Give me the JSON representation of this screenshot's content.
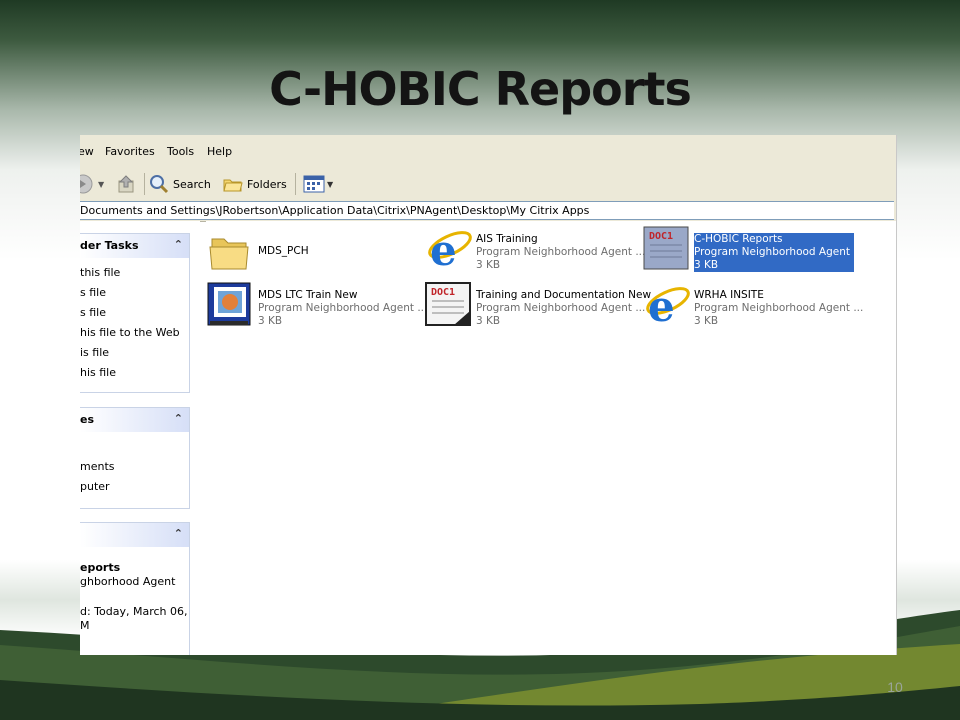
{
  "slide": {
    "title": "C-HOBIC Reports",
    "page_number": "10"
  },
  "menu": [
    "ew",
    "Favorites",
    "Tools",
    "Help"
  ],
  "toolbar": {
    "search_label": "Search",
    "folders_label": "Folders"
  },
  "address": {
    "path": "Documents and Settings\\JRobertson\\Application Data\\Citrix\\PNAgent\\Desktop\\My Citrix Apps"
  },
  "left_panel": {
    "tasks": {
      "title": "der Tasks",
      "items": [
        "this file",
        "s file",
        "s file",
        "his file to the Web",
        "is file",
        "his file"
      ]
    },
    "places": {
      "title": "es",
      "items": [
        "ments",
        "puter"
      ]
    },
    "details": {
      "title": "",
      "name": "eports",
      "type": "ghborhood Agent",
      "modified": "d: Today, March 06,",
      "time": "M"
    }
  },
  "files": [
    {
      "name": "MDS_PCH",
      "desc": "",
      "size": "",
      "icon": "folder-icon"
    },
    {
      "name": "AIS Training",
      "desc": "Program Neighborhood Agent ...",
      "size": "3 KB",
      "icon": "ie-icon"
    },
    {
      "name": "C-HOBIC Reports",
      "desc": "Program Neighborhood Agent ...",
      "size": "3 KB",
      "icon": "document-icon"
    },
    {
      "name": "MDS LTC Train New",
      "desc": "Program Neighborhood Agent ...",
      "size": "3 KB",
      "icon": "app-window-icon"
    },
    {
      "name": "Training and Documentation New",
      "desc": "Program Neighborhood Agent ...",
      "size": "3 KB",
      "icon": "document-icon"
    },
    {
      "name": "WRHA INSITE",
      "desc": "Program Neighborhood Agent ...",
      "size": "3 KB",
      "icon": "ie-icon"
    }
  ],
  "colors": {
    "selection": "#316ac5",
    "menu_bg": "#ece9d8",
    "title_text": "#141414"
  }
}
